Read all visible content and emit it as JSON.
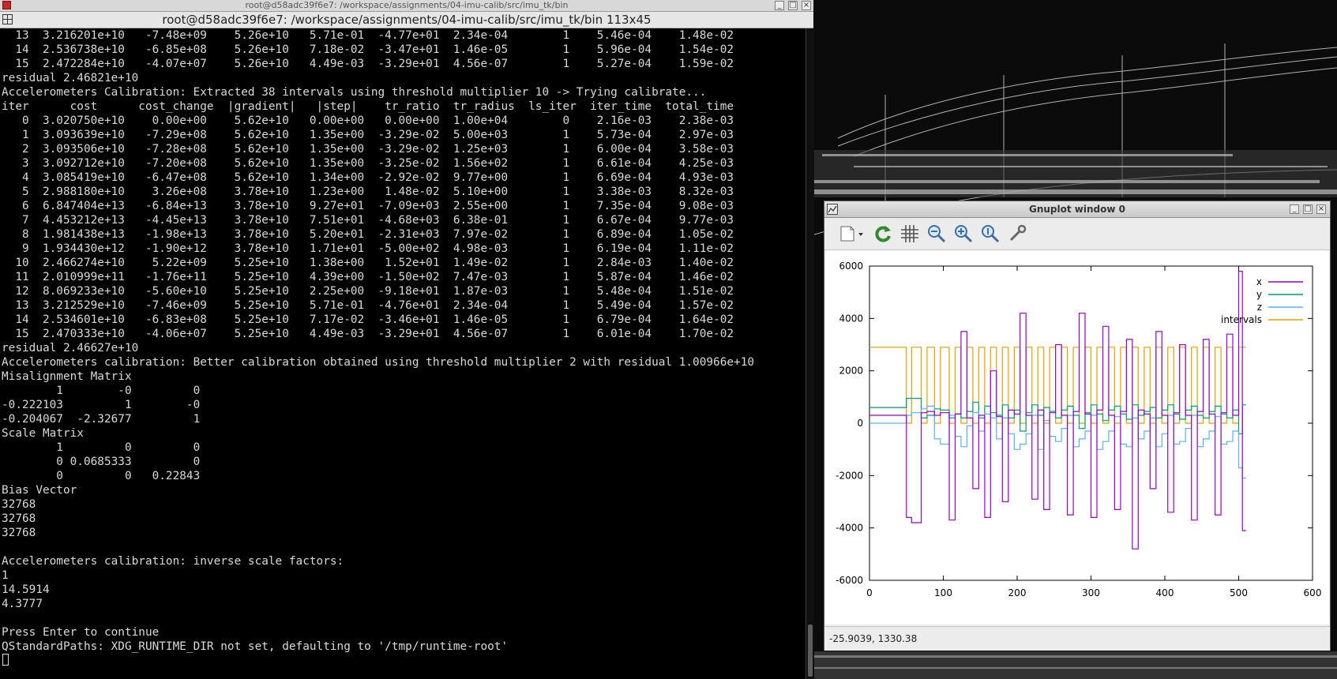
{
  "terminal": {
    "window_title": "root@d58adc39f6e7: /workspace/assignments/04-imu-calib/src/imu_tk/bin",
    "header_title": "root@d58adc39f6e7: /workspace/assignments/04-imu-calib/src/imu_tk/bin 113x45",
    "lines": [
      "  13  3.216201e+10   -7.48e+09    5.26e+10   5.71e-01  -4.77e+01  2.34e-04        1    5.46e-04    1.48e-02",
      "  14  2.536738e+10   -6.85e+08    5.26e+10   7.18e-02  -3.47e+01  1.46e-05        1    5.96e-04    1.54e-02",
      "  15  2.472284e+10   -4.07e+07    5.26e+10   4.49e-03  -3.29e+01  4.56e-07        1    5.27e-04    1.59e-02",
      "residual 2.46821e+10",
      "Accelerometers Calibration: Extracted 38 intervals using threshold multiplier 10 -> Trying calibrate...",
      "iter      cost      cost_change  |gradient|   |step|    tr_ratio  tr_radius  ls_iter  iter_time  total_time",
      "   0  3.020750e+10    0.00e+00    5.62e+10   0.00e+00   0.00e+00  1.00e+04        0    2.16e-03    2.38e-03",
      "   1  3.093639e+10   -7.29e+08    5.62e+10   1.35e+00  -3.29e-02  5.00e+03        1    5.73e-04    2.97e-03",
      "   2  3.093506e+10   -7.28e+08    5.62e+10   1.35e+00  -3.29e-02  1.25e+03        1    6.00e-04    3.58e-03",
      "   3  3.092712e+10   -7.20e+08    5.62e+10   1.35e+00  -3.25e-02  1.56e+02        1    6.61e-04    4.25e-03",
      "   4  3.085419e+10   -6.47e+08    5.62e+10   1.34e+00  -2.92e-02  9.77e+00        1    6.69e-04    4.93e-03",
      "   5  2.988180e+10    3.26e+08    3.78e+10   1.23e+00   1.48e-02  5.10e+00        1    3.38e-03    8.32e-03",
      "   6  6.847404e+13   -6.84e+13    3.78e+10   9.27e+01  -7.09e+03  2.55e+00        1    7.35e-04    9.08e-03",
      "   7  4.453212e+13   -4.45e+13    3.78e+10   7.51e+01  -4.68e+03  6.38e-01        1    6.67e-04    9.77e-03",
      "   8  1.981438e+13   -1.98e+13    3.78e+10   5.20e+01  -2.31e+03  7.97e-02        1    6.89e-04    1.05e-02",
      "   9  1.934430e+12   -1.90e+12    3.78e+10   1.71e+01  -5.00e+02  4.98e-03        1    6.19e-04    1.11e-02",
      "  10  2.466274e+10    5.22e+09    5.25e+10   1.38e+00   1.52e+01  1.49e-02        1    2.84e-03    1.40e-02",
      "  11  2.010999e+11   -1.76e+11    5.25e+10   4.39e+00  -1.50e+02  7.47e-03        1    5.87e-04    1.46e-02",
      "  12  8.069233e+10   -5.60e+10    5.25e+10   2.25e+00  -9.18e+01  1.87e-03        1    5.48e-04    1.51e-02",
      "  13  3.212529e+10   -7.46e+09    5.25e+10   5.71e-01  -4.76e+01  2.34e-04        1    5.49e-04    1.57e-02",
      "  14  2.534601e+10   -6.83e+08    5.25e+10   7.17e-02  -3.46e+01  1.46e-05        1    6.79e-04    1.64e-02",
      "  15  2.470333e+10   -4.06e+07    5.25e+10   4.49e-03  -3.29e+01  4.56e-07        1    6.01e-04    1.70e-02",
      "residual 2.46627e+10",
      "Accelerometers calibration: Better calibration obtained using threshold multiplier 2 with residual 1.00966e+10",
      "Misalignment Matrix",
      "        1        -0         0",
      "-0.222103         1        -0",
      "-0.204067  -2.32677         1",
      "Scale Matrix",
      "        1         0         0",
      "        0 0.0685333         0",
      "        0         0   0.22843",
      "Bias Vector",
      "32768",
      "32768",
      "32768",
      "",
      "Accelerometers calibration: inverse scale factors:",
      "1",
      "14.5914",
      "4.3777",
      "",
      "Press Enter to continue",
      "QStandardPaths: XDG_RUNTIME_DIR not set, defaulting to '/tmp/runtime-root'"
    ]
  },
  "gnuplot": {
    "title": "Gnuplot window 0",
    "status": "-25.9039,  1330.38",
    "toolbar": [
      "export-icon",
      "replot-icon",
      "grid-icon",
      "zoom-out-icon",
      "zoom-in-icon",
      "zoom-fit-icon",
      "settings-icon"
    ]
  },
  "chart_data": {
    "type": "line",
    "title": "",
    "xlabel": "",
    "ylabel": "",
    "xlim": [
      0,
      600
    ],
    "ylim": [
      -6000,
      6000
    ],
    "xticks": [
      0,
      100,
      200,
      300,
      400,
      500,
      600
    ],
    "yticks": [
      6000,
      4000,
      2000,
      0,
      -2000,
      -4000,
      -6000
    ],
    "grid": false,
    "legend_position": "top-right",
    "series": [
      {
        "name": "x",
        "color": "#9400d3"
      },
      {
        "name": "y",
        "color": "#009e73"
      },
      {
        "name": "z",
        "color": "#56b4e9"
      },
      {
        "name": "intervals",
        "color": "#e69f00"
      }
    ],
    "segments": [
      {
        "x0": 0,
        "x1": 50,
        "x": 300,
        "y": 600,
        "z": 0,
        "intervals": 2900
      },
      {
        "x0": 50,
        "x1": 57,
        "x": -3600,
        "y": 950,
        "z": 300,
        "intervals": 0
      },
      {
        "x0": 57,
        "x1": 70,
        "x": -3800,
        "y": 950,
        "z": 400,
        "intervals": 2900
      },
      {
        "x0": 70,
        "x1": 78,
        "x": 400,
        "y": 200,
        "z": 550,
        "intervals": 0
      },
      {
        "x0": 78,
        "x1": 88,
        "x": 450,
        "y": 300,
        "z": 650,
        "intervals": 2900
      },
      {
        "x0": 88,
        "x1": 96,
        "x": 300,
        "y": 550,
        "z": -600,
        "intervals": 0
      },
      {
        "x0": 96,
        "x1": 108,
        "x": 400,
        "y": 500,
        "z": -800,
        "intervals": 2900
      },
      {
        "x0": 108,
        "x1": 116,
        "x": -3700,
        "y": 200,
        "z": 300,
        "intervals": 0
      },
      {
        "x0": 116,
        "x1": 124,
        "x": 350,
        "y": 350,
        "z": -500,
        "intervals": 2900
      },
      {
        "x0": 124,
        "x1": 132,
        "x": 3500,
        "y": 200,
        "z": -900,
        "intervals": 0
      },
      {
        "x0": 132,
        "x1": 140,
        "x": 200,
        "y": 450,
        "z": -100,
        "intervals": 2900
      },
      {
        "x0": 140,
        "x1": 148,
        "x": -2500,
        "y": 800,
        "z": 400,
        "intervals": 0
      },
      {
        "x0": 148,
        "x1": 156,
        "x": 300,
        "y": 200,
        "z": -300,
        "intervals": 2900
      },
      {
        "x0": 156,
        "x1": 164,
        "x": -3600,
        "y": 650,
        "z": 350,
        "intervals": 0
      },
      {
        "x0": 164,
        "x1": 172,
        "x": 2000,
        "y": 400,
        "z": 200,
        "intervals": 2900
      },
      {
        "x0": 172,
        "x1": 180,
        "x": 250,
        "y": 300,
        "z": -600,
        "intervals": 0
      },
      {
        "x0": 180,
        "x1": 188,
        "x": -3000,
        "y": 700,
        "z": 200,
        "intervals": 2900
      },
      {
        "x0": 188,
        "x1": 196,
        "x": 500,
        "y": 200,
        "z": -400,
        "intervals": 0
      },
      {
        "x0": 196,
        "x1": 204,
        "x": 350,
        "y": 500,
        "z": -1000,
        "intervals": 2900
      },
      {
        "x0": 204,
        "x1": 212,
        "x": 4200,
        "y": -300,
        "z": -800,
        "intervals": 0
      },
      {
        "x0": 212,
        "x1": 220,
        "x": 300,
        "y": 400,
        "z": -400,
        "intervals": 2900
      },
      {
        "x0": 220,
        "x1": 228,
        "x": -2900,
        "y": 700,
        "z": 300,
        "intervals": 0
      },
      {
        "x0": 228,
        "x1": 236,
        "x": 500,
        "y": 300,
        "z": -1000,
        "intervals": 2900
      },
      {
        "x0": 236,
        "x1": 244,
        "x": -3300,
        "y": 600,
        "z": 100,
        "intervals": 0
      },
      {
        "x0": 244,
        "x1": 252,
        "x": 400,
        "y": 450,
        "z": -500,
        "intervals": 2900
      },
      {
        "x0": 252,
        "x1": 260,
        "x": 3000,
        "y": 200,
        "z": -700,
        "intervals": 0
      },
      {
        "x0": 260,
        "x1": 268,
        "x": 300,
        "y": 500,
        "z": -200,
        "intervals": 2900
      },
      {
        "x0": 268,
        "x1": 276,
        "x": -3500,
        "y": 650,
        "z": 300,
        "intervals": 0
      },
      {
        "x0": 276,
        "x1": 284,
        "x": 450,
        "y": 300,
        "z": -900,
        "intervals": 2900
      },
      {
        "x0": 284,
        "x1": 292,
        "x": 4200,
        "y": -200,
        "z": -600,
        "intervals": 0
      },
      {
        "x0": 292,
        "x1": 300,
        "x": 350,
        "y": 400,
        "z": -300,
        "intervals": 2900
      },
      {
        "x0": 300,
        "x1": 308,
        "x": -3600,
        "y": 700,
        "z": 300,
        "intervals": 0
      },
      {
        "x0": 308,
        "x1": 316,
        "x": 500,
        "y": 350,
        "z": -1000,
        "intervals": 2900
      },
      {
        "x0": 316,
        "x1": 324,
        "x": 3700,
        "y": 100,
        "z": -700,
        "intervals": 0
      },
      {
        "x0": 324,
        "x1": 332,
        "x": 300,
        "y": 500,
        "z": -300,
        "intervals": 2900
      },
      {
        "x0": 332,
        "x1": 340,
        "x": -3300,
        "y": 650,
        "z": 250,
        "intervals": 0
      },
      {
        "x0": 340,
        "x1": 348,
        "x": 450,
        "y": 350,
        "z": -800,
        "intervals": 2900
      },
      {
        "x0": 348,
        "x1": 356,
        "x": 3200,
        "y": 150,
        "z": -900,
        "intervals": 0
      },
      {
        "x0": 356,
        "x1": 364,
        "x": -4800,
        "y": 700,
        "z": 200,
        "intervals": 2900
      },
      {
        "x0": 364,
        "x1": 372,
        "x": 500,
        "y": 300,
        "z": -600,
        "intervals": 0
      },
      {
        "x0": 372,
        "x1": 380,
        "x": 350,
        "y": 450,
        "z": -300,
        "intervals": 2900
      },
      {
        "x0": 380,
        "x1": 388,
        "x": -2500,
        "y": 600,
        "z": 200,
        "intervals": 0
      },
      {
        "x0": 388,
        "x1": 396,
        "x": 3500,
        "y": 200,
        "z": -900,
        "intervals": 2900
      },
      {
        "x0": 396,
        "x1": 404,
        "x": 300,
        "y": 500,
        "z": -400,
        "intervals": 0
      },
      {
        "x0": 404,
        "x1": 412,
        "x": -3400,
        "y": 700,
        "z": 300,
        "intervals": 2900
      },
      {
        "x0": 412,
        "x1": 420,
        "x": 400,
        "y": 350,
        "z": -800,
        "intervals": 0
      },
      {
        "x0": 420,
        "x1": 428,
        "x": 3000,
        "y": 150,
        "z": -700,
        "intervals": 2900
      },
      {
        "x0": 428,
        "x1": 436,
        "x": 300,
        "y": 500,
        "z": -200,
        "intervals": 0
      },
      {
        "x0": 436,
        "x1": 444,
        "x": -3700,
        "y": 650,
        "z": 300,
        "intervals": 2900
      },
      {
        "x0": 444,
        "x1": 452,
        "x": 450,
        "y": 300,
        "z": -900,
        "intervals": 0
      },
      {
        "x0": 452,
        "x1": 460,
        "x": 3200,
        "y": 200,
        "z": -600,
        "intervals": 2900
      },
      {
        "x0": 460,
        "x1": 468,
        "x": 350,
        "y": 450,
        "z": -300,
        "intervals": 0
      },
      {
        "x0": 468,
        "x1": 476,
        "x": -3500,
        "y": 650,
        "z": 250,
        "intervals": 2900
      },
      {
        "x0": 476,
        "x1": 484,
        "x": 400,
        "y": 350,
        "z": -800,
        "intervals": 0
      },
      {
        "x0": 484,
        "x1": 492,
        "x": 3400,
        "y": 200,
        "z": -700,
        "intervals": 2900
      },
      {
        "x0": 492,
        "x1": 500,
        "x": 300,
        "y": 500,
        "z": -300,
        "intervals": 0
      },
      {
        "x0": 500,
        "x1": 505,
        "x": 5800,
        "y": -400,
        "z": -1700,
        "intervals": 2900
      },
      {
        "x0": 505,
        "x1": 510,
        "x": -4100,
        "y": 700,
        "z": -2100,
        "intervals": 2900
      }
    ]
  }
}
